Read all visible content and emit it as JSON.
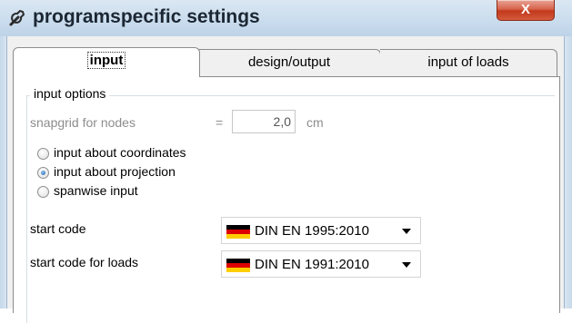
{
  "window": {
    "title": "programspecific settings",
    "close_label": "X"
  },
  "tabs": [
    {
      "label": "input",
      "selected": true
    },
    {
      "label": "design/output",
      "selected": false
    },
    {
      "label": "input of loads",
      "selected": false
    }
  ],
  "input_options": {
    "group_label": "input options",
    "snapgrid": {
      "label": "snapgrid for nodes",
      "equals": "=",
      "value": "2,0",
      "unit": "cm",
      "enabled": false
    },
    "radios": [
      {
        "label": "input about coordinates",
        "checked": false
      },
      {
        "label": "input about projection",
        "checked": true
      },
      {
        "label": "spanwise input",
        "checked": false
      }
    ],
    "start_code": {
      "label": "start code",
      "value": "DIN EN 1995:2010",
      "flag": "german-flag-icon"
    },
    "start_code_loads": {
      "label": "start code for loads",
      "value": "DIN EN 1991:2010",
      "flag": "german-flag-icon"
    }
  },
  "colors": {
    "flag_black": "#000000",
    "flag_red": "#dd0000",
    "flag_gold": "#ffce00",
    "close_red": "#c2391c"
  }
}
